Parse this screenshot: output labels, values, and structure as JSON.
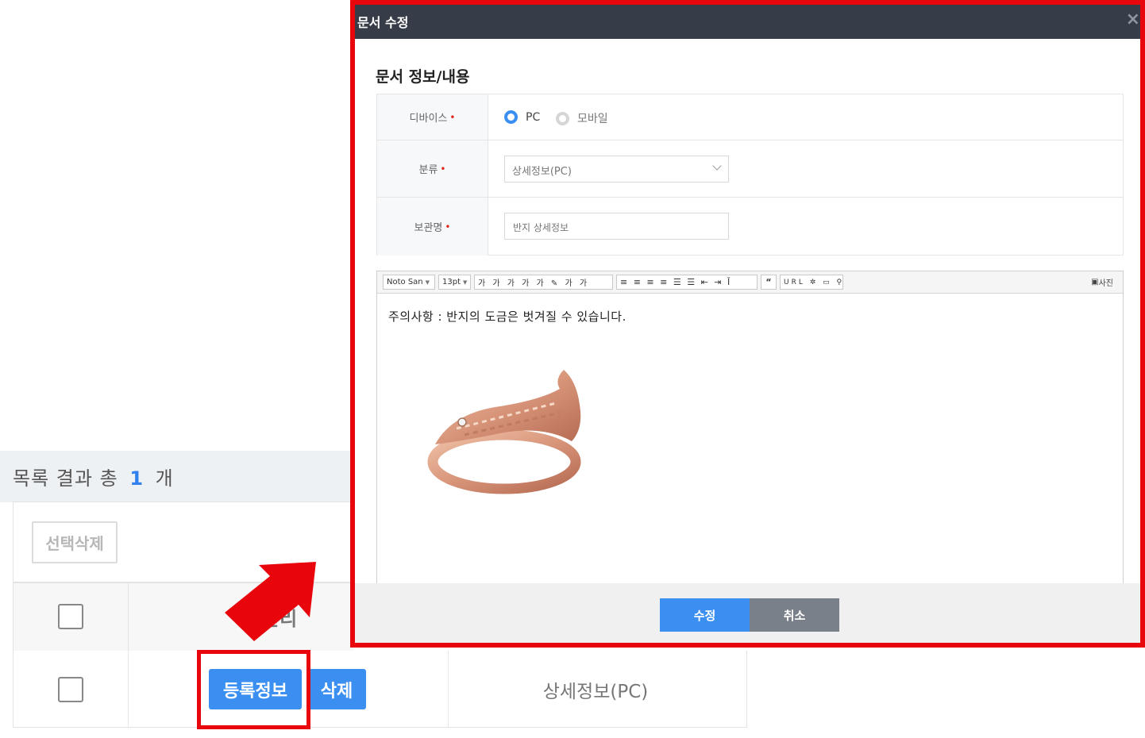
{
  "list": {
    "summary_prefix": "목록 결과 총",
    "summary_count": "1",
    "summary_suffix": "개",
    "select_delete_label": "선택삭제",
    "header_manage_label": "관리",
    "row": {
      "register_info_label": "등록정보",
      "delete_label": "삭제",
      "category": "상세정보(PC)"
    }
  },
  "modal": {
    "title": "문서 수정",
    "close_symbol": "×",
    "section_title": "문서 정보/내용",
    "device": {
      "label": "디바이스",
      "required_mark": "•",
      "options": [
        "PC",
        "모바일"
      ],
      "selected": "PC"
    },
    "category": {
      "label": "분류",
      "required_mark": "•",
      "selected_value": "상세정보(PC)"
    },
    "storage_name": {
      "label": "보관명",
      "required_mark": "•",
      "value": "반지 상세정보"
    },
    "editor": {
      "font": "Noto San",
      "size": "13pt",
      "format_buttons": "가 가 가 가 가 ✎ 가 가",
      "align_buttons": "≡ ≡ ≡ ≡ ☰ ☰ ⇤ ⇥ Ī",
      "quote": "“",
      "misc_buttons": "URL ✲ ▭ ⚲",
      "photo_label": "사진",
      "content_text": "주의사항 : 반지의 도금은 벗겨질 수 있습니다.",
      "image": "rose-gold-fish-ring"
    },
    "footer": {
      "submit_label": "수정",
      "cancel_label": "취소"
    }
  },
  "colors": {
    "primary": "#3b8ff0",
    "header_dark": "#373d48",
    "highlight_red": "#e8060c",
    "cancel_gray": "#7a808a"
  }
}
